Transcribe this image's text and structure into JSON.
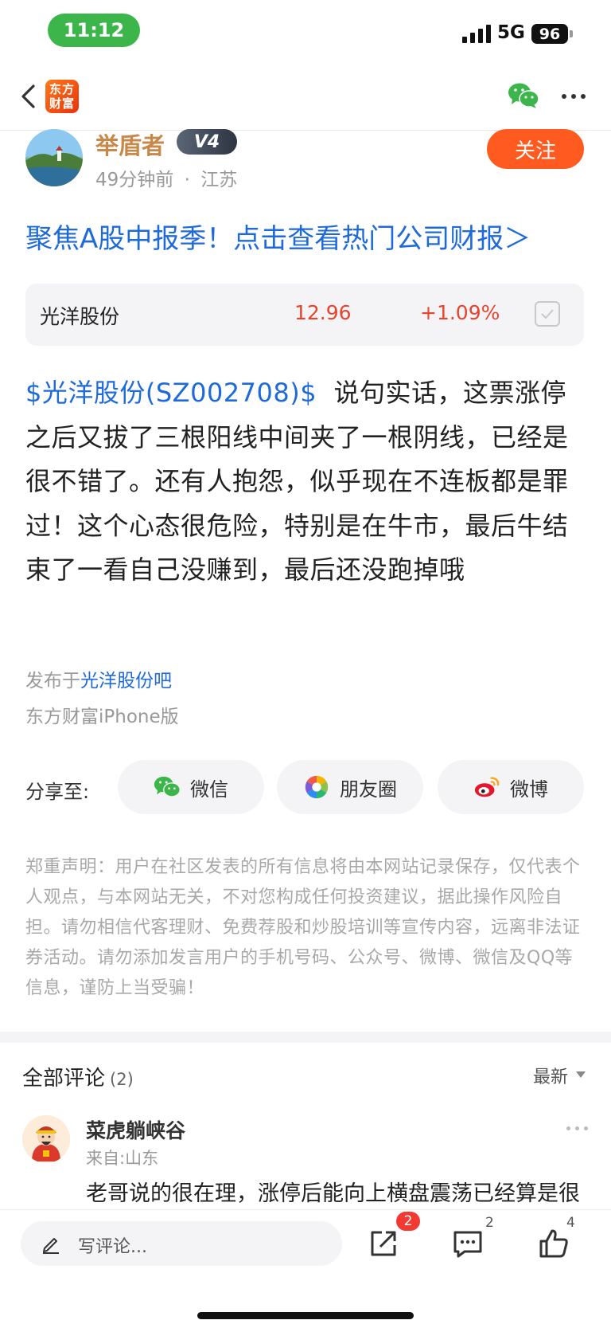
{
  "status_bar": {
    "time": "11:12",
    "network": "5G",
    "battery": "96"
  },
  "nav": {
    "logo_text": "东方财富"
  },
  "author": {
    "name": "举盾者",
    "level": "V4",
    "time_ago": "49分钟前",
    "separator": "·",
    "location": "江苏",
    "follow_label": "关注"
  },
  "promo": {
    "text": "聚焦A股中报季！点击查看热门公司财报＞"
  },
  "stock": {
    "name": "光洋股份",
    "price": "12.96",
    "change": "+1.09%"
  },
  "post": {
    "stock_tag": "$光洋股份(SZ002708)$",
    "body": "  说句实话，这票涨停之后又拔了三根阳线中间夹了一根阴线，已经是很不错了。还有人抱怨，似乎现在不连板都是罪过！这个心态很危险，特别是在牛市，最后牛结束了一看自己没赚到，最后还没跑掉哦",
    "published_prefix": "发布于",
    "forum": "光洋股份吧",
    "client": "东方财富iPhone版"
  },
  "share": {
    "label": "分享至:",
    "wechat": "微信",
    "moments": "朋友圈",
    "weibo": "微博"
  },
  "disclaimer": "郑重声明：用户在社区发表的所有信息将由本网站记录保存，仅代表个人观点，与本网站无关，不对您构成任何投资建议，据此操作风险自担。请勿相信代客理财、免费荐股和炒股培训等宣传内容，远离非法证券活动。请勿添加发言用户的手机号码、公众号、微博、微信及QQ等信息，谨防上当受骗！",
  "comments": {
    "title": "全部评论",
    "count": "(2)",
    "sort": "最新",
    "items": [
      {
        "name": "菜虎躺峡谷",
        "location": "来自:山东",
        "text": "老哥说的很在理，涨停后能向上横盘震荡已经算是很"
      }
    ]
  },
  "bottom_bar": {
    "placeholder": "写评论...",
    "share_badge": "2",
    "comment_count": "2",
    "like_count": "4"
  },
  "colors": {
    "accent": "#ff5a1f",
    "link": "#1f6ad9",
    "up": "#e8432c",
    "wechat": "#3cb64a"
  }
}
